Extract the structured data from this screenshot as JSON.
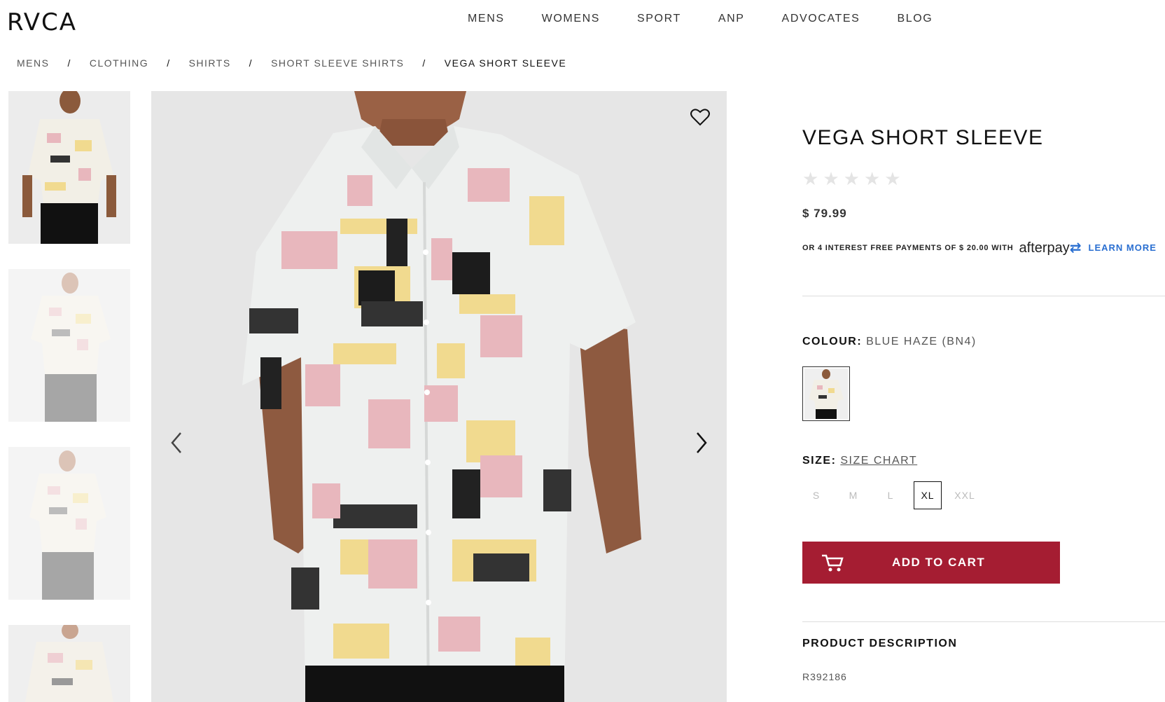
{
  "header": {
    "logo": "RVCA",
    "nav": [
      "MENS",
      "WOMENS",
      "SPORT",
      "ANP",
      "ADVOCATES",
      "BLOG"
    ]
  },
  "breadcrumb": {
    "items": [
      "MENS",
      "CLOTHING",
      "SHIRTS",
      "SHORT SLEEVE SHIRTS"
    ],
    "separator": "/",
    "current": "VEGA SHORT SLEEVE"
  },
  "gallery": {
    "thumbnails": [
      "thumbnail-front",
      "thumbnail-full-front",
      "thumbnail-side",
      "thumbnail-detail"
    ],
    "icons": {
      "favorite": "heart-icon",
      "prev": "chevron-left-icon",
      "next": "chevron-right-icon"
    }
  },
  "product": {
    "title": "VEGA SHORT SLEEVE",
    "rating": 0,
    "rating_max": 5,
    "price": "$ 79.99",
    "afterpay_text": "OR 4 INTEREST FREE PAYMENTS OF $ 20.00 WITH",
    "afterpay_logo": "afterpay",
    "learn_more": "LEARN MORE",
    "colour_label": "COLOUR:",
    "colour_value": "BLUE HAZE (BN4)",
    "size_label": "SIZE:",
    "size_chart": "SIZE CHART",
    "sizes": [
      "S",
      "M",
      "L",
      "XL",
      "XXL"
    ],
    "selected_size": "XL",
    "add_to_cart": "ADD TO CART",
    "description_title": "PRODUCT DESCRIPTION",
    "sku": "R392186"
  },
  "colors": {
    "cta": "#a51d32",
    "afterpay_link": "#2a6fd1",
    "image_bg": "#e6e6e6"
  }
}
